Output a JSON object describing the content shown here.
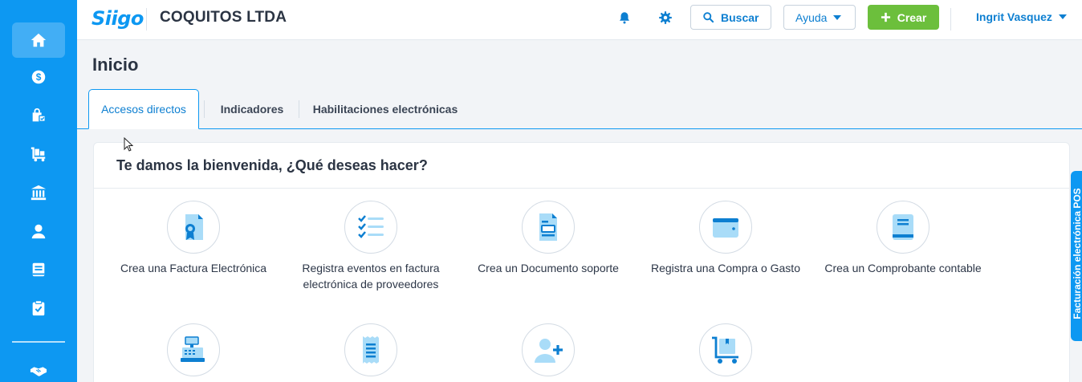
{
  "app": {
    "logo_text": "Siigo",
    "company": "COQUITOS LTDA"
  },
  "sidebar": {
    "items": [
      {
        "icon": "home-icon",
        "name": "sidebar-item-home",
        "active": true
      },
      {
        "icon": "dollar-icon",
        "name": "sidebar-item-sales"
      },
      {
        "icon": "shopping-bag-icon",
        "name": "sidebar-item-purchases"
      },
      {
        "icon": "warehouse-cart-icon",
        "name": "sidebar-item-inventory"
      },
      {
        "icon": "bank-icon",
        "name": "sidebar-item-banks"
      },
      {
        "icon": "user-icon",
        "name": "sidebar-item-contacts"
      },
      {
        "icon": "book-icon",
        "name": "sidebar-item-accounting"
      },
      {
        "icon": "clipboard-check-icon",
        "name": "sidebar-item-reports"
      },
      {
        "icon": "handshake-icon",
        "name": "sidebar-item-partners"
      }
    ]
  },
  "topbar": {
    "search_label": "Buscar",
    "help_label": "Ayuda",
    "create_label": "Crear",
    "user_name": "Ingrit Vasquez"
  },
  "page": {
    "title": "Inicio",
    "tabs": [
      {
        "label": "Accesos directos",
        "active": true
      },
      {
        "label": "Indicadores"
      },
      {
        "label": "Habilitaciones electrónicas"
      }
    ]
  },
  "welcome": {
    "title": "Te damos la bienvenida, ¿Qué deseas hacer?",
    "actions": [
      {
        "label": "Crea una Factura Electrónica",
        "icon": "invoice-ribbon-icon"
      },
      {
        "label": "Registra eventos en factura electrónica de proveedores",
        "icon": "checklist-icon"
      },
      {
        "label": "Crea un Documento soporte",
        "icon": "document-support-icon"
      },
      {
        "label": "Registra una Compra o Gasto",
        "icon": "wallet-icon"
      },
      {
        "label": "Crea un Comprobante contable",
        "icon": "ledger-book-icon"
      },
      {
        "label": "",
        "icon": "cash-register-icon"
      },
      {
        "label": "",
        "icon": "receipt-icon"
      },
      {
        "label": "",
        "icon": "add-user-icon"
      },
      {
        "label": "",
        "icon": "cart-box-icon"
      }
    ]
  },
  "side_tab": {
    "label": "Facturación electrónica POS"
  },
  "colors": {
    "primary": "#0d98f2",
    "link": "#0d7fd1",
    "create": "#6cbf3c",
    "icon_light": "#a9dcf8",
    "icon_dark": "#0d7fd1"
  }
}
